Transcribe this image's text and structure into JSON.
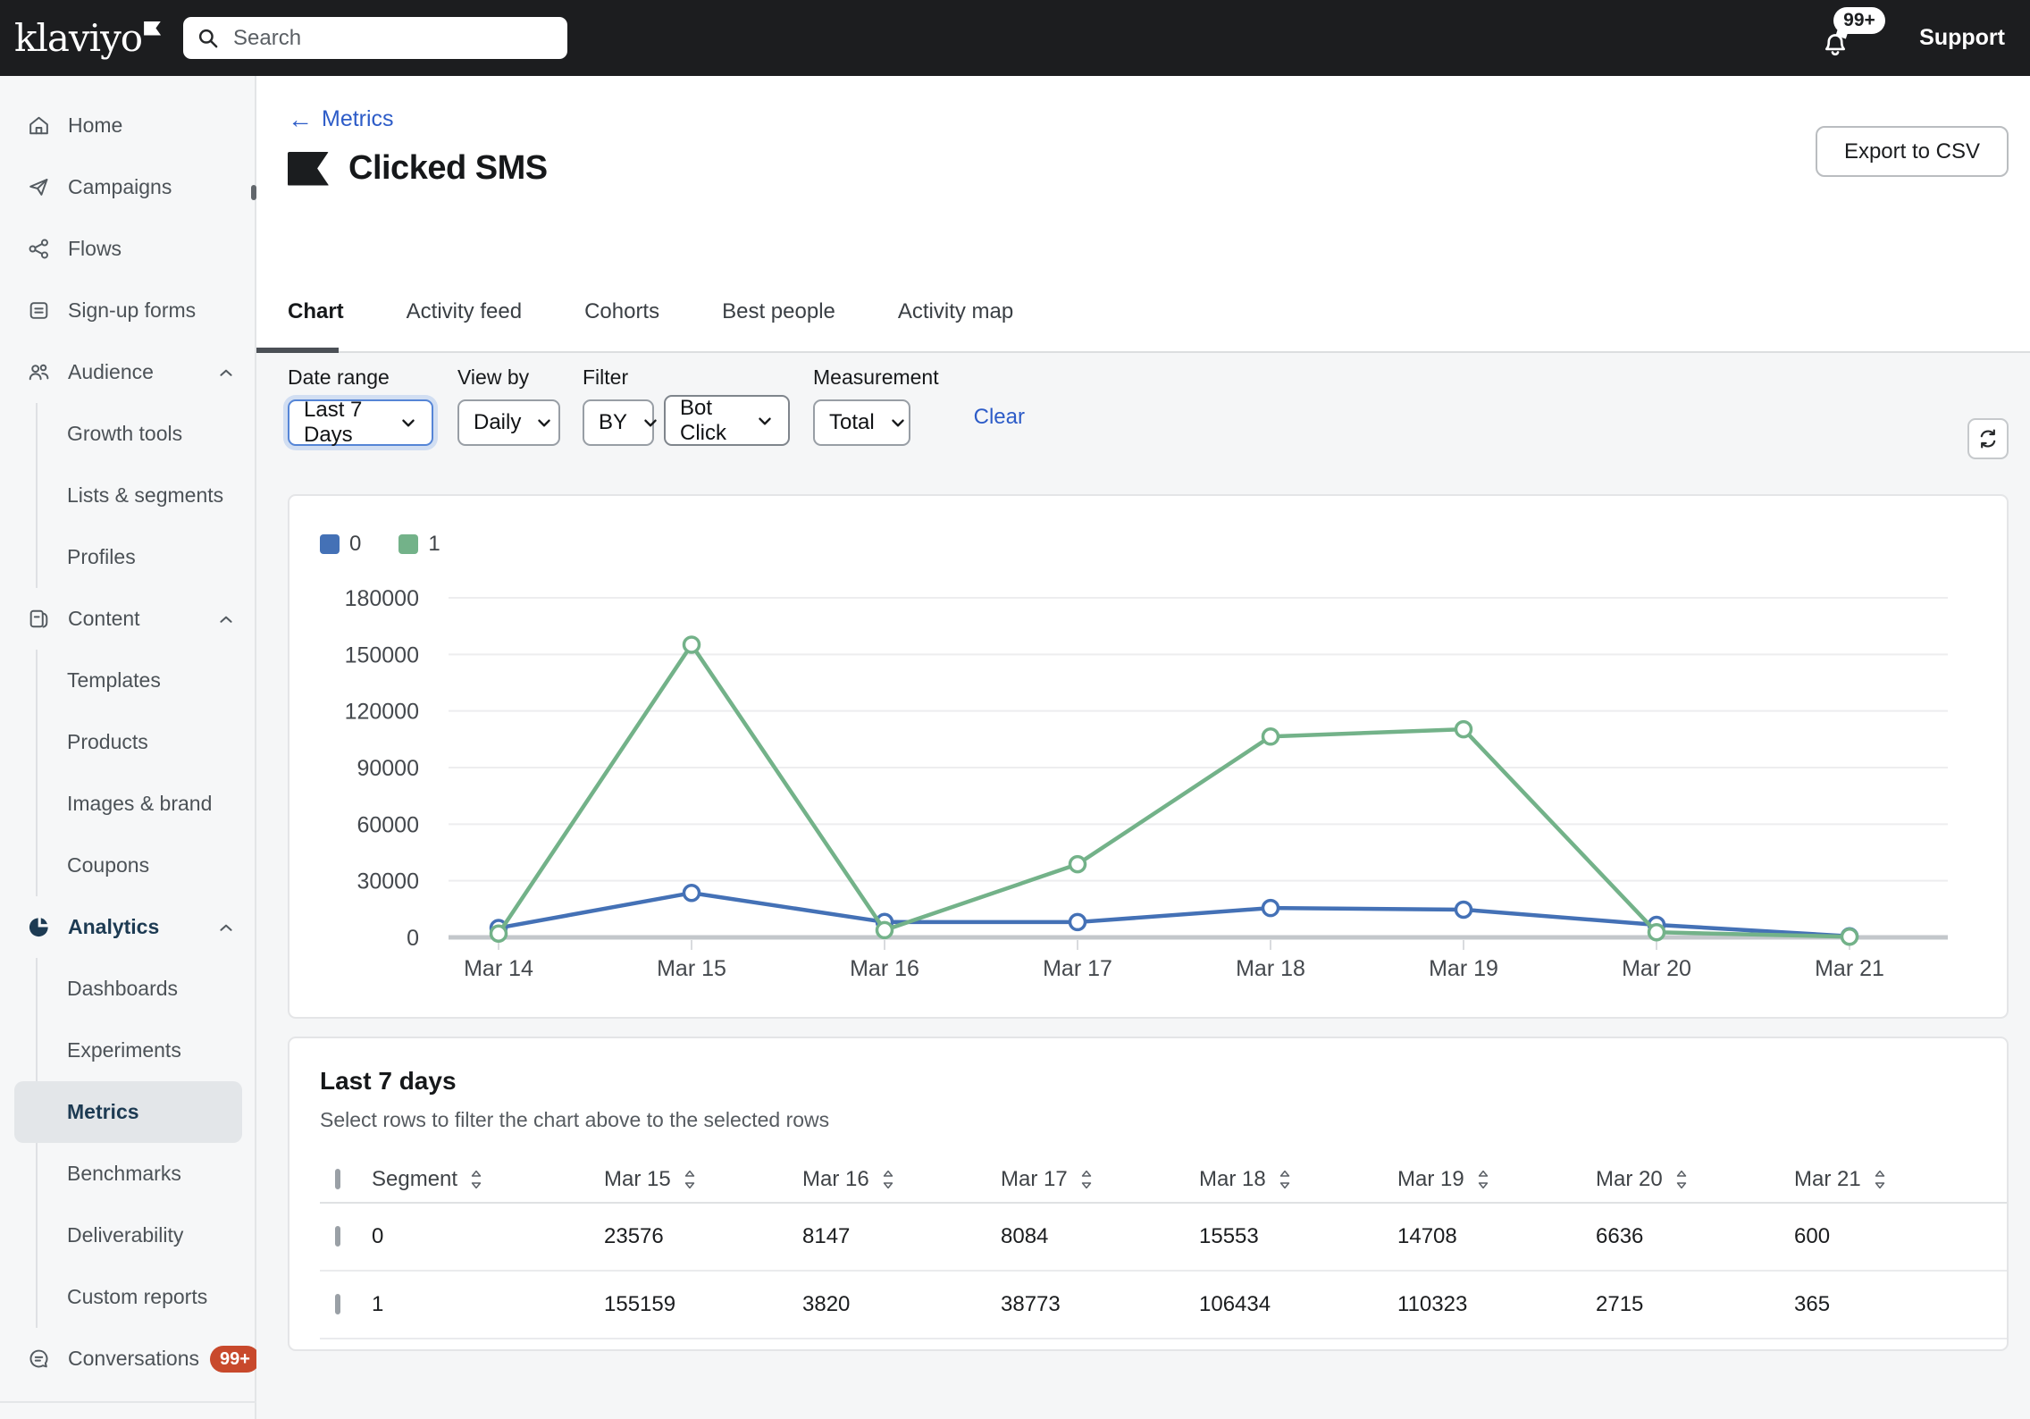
{
  "topbar": {
    "logo_text": "klaviyo",
    "search_placeholder": "Search",
    "notification_count": "99+",
    "support_label": "Support"
  },
  "sidebar": {
    "items": [
      {
        "label": "Home",
        "icon": "home-icon"
      },
      {
        "label": "Campaigns",
        "icon": "campaigns-icon"
      },
      {
        "label": "Flows",
        "icon": "flows-icon"
      },
      {
        "label": "Sign-up forms",
        "icon": "signup-forms-icon"
      },
      {
        "label": "Audience",
        "icon": "audience-icon",
        "expanded": true,
        "children": [
          "Growth tools",
          "Lists & segments",
          "Profiles"
        ]
      },
      {
        "label": "Content",
        "icon": "content-icon",
        "expanded": true,
        "children": [
          "Templates",
          "Products",
          "Images & brand",
          "Coupons"
        ]
      },
      {
        "label": "Analytics",
        "icon": "analytics-icon",
        "expanded": true,
        "active": true,
        "children": [
          "Dashboards",
          "Experiments",
          "Metrics",
          "Benchmarks",
          "Deliverability",
          "Custom reports"
        ],
        "active_child": "Metrics"
      },
      {
        "label": "Conversations",
        "icon": "conversations-icon",
        "badge": "99+"
      }
    ]
  },
  "header": {
    "back_label": "Metrics",
    "back_arrow": "←",
    "title": "Clicked SMS",
    "export_label": "Export to CSV"
  },
  "tabs": {
    "items": [
      "Chart",
      "Activity feed",
      "Cohorts",
      "Best people",
      "Activity map"
    ],
    "active": "Chart"
  },
  "filters": {
    "date_range": {
      "label": "Date range",
      "value": "Last 7 Days"
    },
    "view_by": {
      "label": "View by",
      "value": "Daily"
    },
    "filter": {
      "label": "Filter",
      "operator": "BY",
      "value": "Bot Click"
    },
    "measurement": {
      "label": "Measurement",
      "value": "Total"
    },
    "clear_label": "Clear"
  },
  "chart_data": {
    "type": "line",
    "x": [
      "Mar 14",
      "Mar 15",
      "Mar 16",
      "Mar 17",
      "Mar 18",
      "Mar 19",
      "Mar 20",
      "Mar 21"
    ],
    "series": [
      {
        "name": "0",
        "color": "#4471b6",
        "values": [
          5000,
          23576,
          8147,
          8084,
          15553,
          14708,
          6636,
          600
        ]
      },
      {
        "name": "1",
        "color": "#73b289",
        "values": [
          2000,
          155159,
          3820,
          38773,
          106434,
          110323,
          2715,
          365
        ]
      }
    ],
    "ylim": [
      0,
      180000
    ],
    "yticks": [
      0,
      30000,
      60000,
      90000,
      120000,
      150000,
      180000
    ],
    "grid": true,
    "legend_position": "top-left",
    "title": "",
    "xlabel": "",
    "ylabel": ""
  },
  "table": {
    "title": "Last 7 days",
    "subtitle": "Select rows to filter the chart above to the selected rows",
    "columns": [
      "Segment",
      "Mar 15",
      "Mar 16",
      "Mar 17",
      "Mar 18",
      "Mar 19",
      "Mar 20",
      "Mar 21"
    ],
    "rows": [
      {
        "segment": "0",
        "values": [
          23576,
          8147,
          8084,
          15553,
          14708,
          6636,
          600
        ]
      },
      {
        "segment": "1",
        "values": [
          155159,
          3820,
          38773,
          106434,
          110323,
          2715,
          365
        ]
      }
    ]
  },
  "colors": {
    "topbar_bg": "#1c1d1f",
    "series0": "#4471b6",
    "series1": "#73b289",
    "link_blue": "#2d5cc8",
    "badge_red": "#c8492c",
    "active_navy": "#1d3b53"
  }
}
